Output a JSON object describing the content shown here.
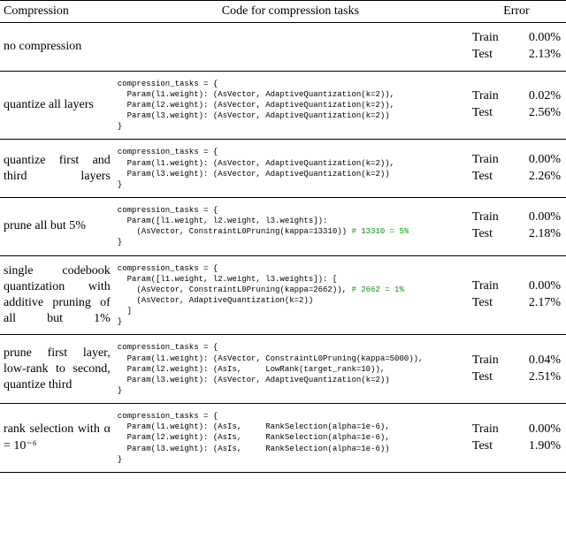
{
  "headers": {
    "compression": "Compression",
    "code": "Code for compression tasks",
    "error": "Error"
  },
  "labels": {
    "train": "Train",
    "test": "Test"
  },
  "rows": [
    {
      "compression": "no compression",
      "justify": false,
      "code_lines": [],
      "train": "0.00%",
      "test": "2.13%"
    },
    {
      "compression": "quantize all layers",
      "justify": false,
      "code_lines": [
        {
          "text": "compression_tasks = {"
        },
        {
          "text": "  Param(l1.weight): (AsVector, AdaptiveQuantization(k=2)),"
        },
        {
          "text": "  Param(l2.weight): (AsVector, AdaptiveQuantization(k=2)),"
        },
        {
          "text": "  Param(l3.weight): (AsVector, AdaptiveQuantization(k=2))"
        },
        {
          "text": "}"
        }
      ],
      "train": "0.02%",
      "test": "2.56%"
    },
    {
      "compression": "quantize first and third layers",
      "justify": true,
      "code_lines": [
        {
          "text": "compression_tasks = {"
        },
        {
          "text": "  Param(l1.weight): (AsVector, AdaptiveQuantization(k=2)),"
        },
        {
          "text": "  Param(l3.weight): (AsVector, AdaptiveQuantization(k=2))"
        },
        {
          "text": "}"
        }
      ],
      "train": "0.00%",
      "test": "2.26%"
    },
    {
      "compression": "prune all but 5%",
      "justify": false,
      "code_lines": [
        {
          "text": "compression_tasks = {"
        },
        {
          "text": "  Param([l1.weight, l2.weight, l3.weights]):"
        },
        {
          "text": "    (AsVector, ConstraintL0Pruning(kappa=13310))",
          "comment": " # 13310 = 5%"
        },
        {
          "text": "}"
        }
      ],
      "train": "0.00%",
      "test": "2.18%"
    },
    {
      "compression": "single codebook quantization with additive pruning of all but 1%",
      "justify": true,
      "code_lines": [
        {
          "text": "compression_tasks = {"
        },
        {
          "text": "  Param([l1.weight, l2.weight, l3.weights]): ["
        },
        {
          "text": "    (AsVector, ConstraintL0Pruning(kappa=2662)),",
          "comment": " # 2662 = 1%"
        },
        {
          "text": "    (AsVector, AdaptiveQuantization(k=2))"
        },
        {
          "text": "  ]"
        },
        {
          "text": "}"
        }
      ],
      "train": "0.00%",
      "test": "2.17%"
    },
    {
      "compression": "prune first layer, low-rank to second, quantize third",
      "justify": false,
      "code_lines": [
        {
          "text": "compression_tasks = {"
        },
        {
          "text": "  Param(l1.weight): (AsVector, ConstraintL0Pruning(kappa=5000)),"
        },
        {
          "text": "  Param(l2.weight): (AsIs,     LowRank(target_rank=10)),"
        },
        {
          "text": "  Param(l3.weight): (AsVector, AdaptiveQuantization(k=2))"
        },
        {
          "text": "}"
        }
      ],
      "train": "0.04%",
      "test": "2.51%"
    },
    {
      "compression": "rank selection with α = 10⁻⁶",
      "justify": false,
      "code_lines": [
        {
          "text": "compression_tasks = {"
        },
        {
          "text": "  Param(l1.weight): (AsIs,     RankSelection(alpha=1e-6),"
        },
        {
          "text": "  Param(l2.weight): (AsIs,     RankSelection(alpha=1e-6),"
        },
        {
          "text": "  Param(l3.weight): (AsIs,     RankSelection(alpha=1e-6))"
        },
        {
          "text": "}"
        }
      ],
      "train": "0.00%",
      "test": "1.90%"
    }
  ]
}
